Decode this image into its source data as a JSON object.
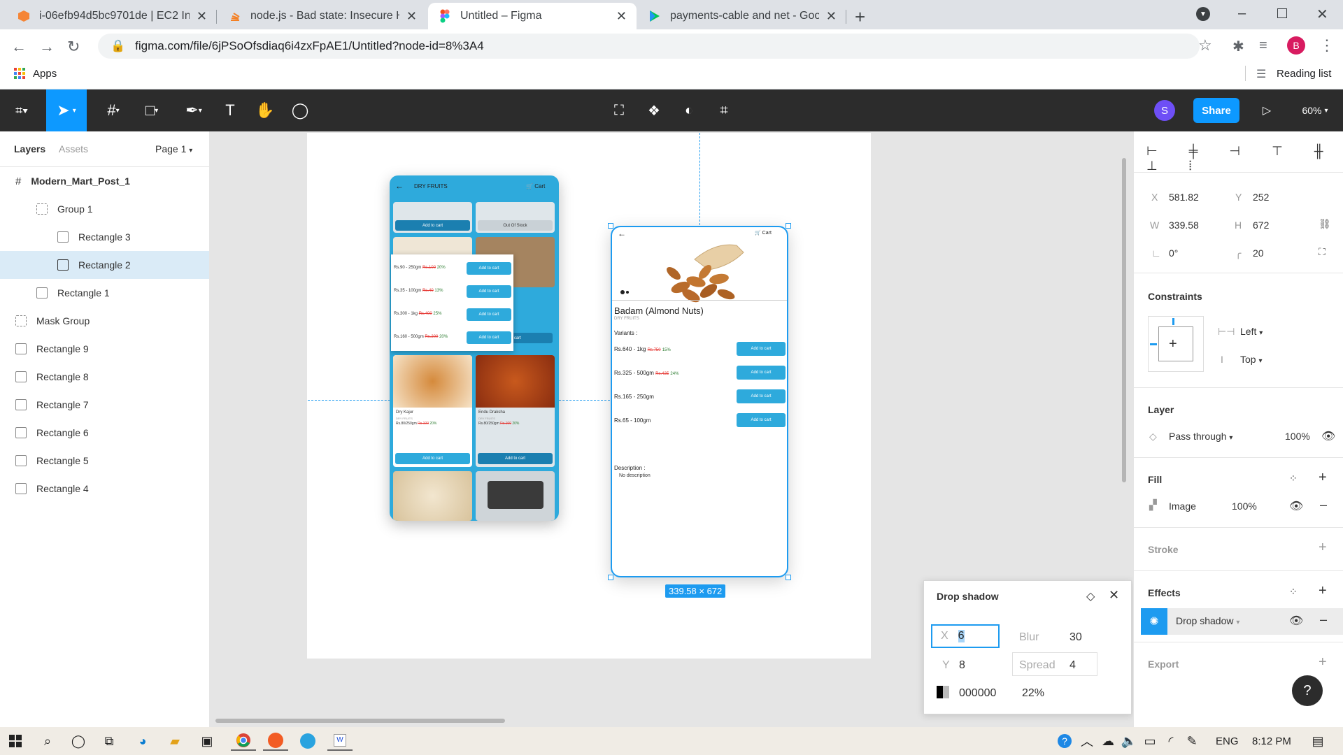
{
  "browser": {
    "tabs": [
      {
        "title": "i-06efb94d5bc9701de | EC2 Insta",
        "icon": "aws-icon"
      },
      {
        "title": "node.js - Bad state: Insecure HTT",
        "icon": "stackoverflow-icon"
      },
      {
        "title": "Untitled – Figma",
        "icon": "figma-icon"
      },
      {
        "title": "payments-cable and net - Googl",
        "icon": "google-play-icon"
      }
    ],
    "url": "figma.com/file/6jPSoOfsdiaq6i4zxFpAE1/Untitled?node-id=8%3A4",
    "apps_label": "Apps",
    "reading_list": "Reading list",
    "profile_initial": "B"
  },
  "figma": {
    "avatar": "S",
    "share_label": "Share",
    "zoom": "60%",
    "left_tabs": {
      "layers": "Layers",
      "assets": "Assets",
      "page": "Page 1"
    },
    "layers": [
      {
        "name": "Modern_Mart_Post_1",
        "indent": 0,
        "type": "frame"
      },
      {
        "name": "Group 1",
        "indent": 1,
        "type": "group"
      },
      {
        "name": "Rectangle 3",
        "indent": 2,
        "type": "image"
      },
      {
        "name": "Rectangle 2",
        "indent": 2,
        "type": "image",
        "selected": true
      },
      {
        "name": "Rectangle 1",
        "indent": 1,
        "type": "rect"
      },
      {
        "name": "Mask Group",
        "indent": 0,
        "type": "group"
      },
      {
        "name": "Rectangle 9",
        "indent": 0,
        "type": "image"
      },
      {
        "name": "Rectangle 8",
        "indent": 0,
        "type": "image"
      },
      {
        "name": "Rectangle 7",
        "indent": 0,
        "type": "rect"
      },
      {
        "name": "Rectangle 6",
        "indent": 0,
        "type": "image"
      },
      {
        "name": "Rectangle 5",
        "indent": 0,
        "type": "image"
      },
      {
        "name": "Rectangle 4",
        "indent": 0,
        "type": "rect"
      }
    ],
    "design": {
      "x": "581.82",
      "y": "252",
      "w": "339.58",
      "h": "672",
      "rotation": "0°",
      "radius": "20",
      "labels": {
        "x": "X",
        "y": "Y",
        "w": "W",
        "h": "H"
      },
      "constraints_title": "Constraints",
      "constraint_h": "Left",
      "constraint_v": "Top",
      "layer_title": "Layer",
      "blend": "Pass through",
      "opacity": "100%",
      "fill_title": "Fill",
      "fill_type": "Image",
      "fill_opacity": "100%",
      "stroke_title": "Stroke",
      "effects_title": "Effects",
      "effect_name": "Drop shadow",
      "export_title": "Export"
    },
    "selection_size": "339.58 × 672",
    "drop_shadow": {
      "title": "Drop shadow",
      "x_label": "X",
      "x": "6",
      "y_label": "Y",
      "y": "8",
      "blur_label": "Blur",
      "blur": "30",
      "spread_label": "Spread",
      "spread": "4",
      "color": "000000",
      "opacity": "22%"
    }
  },
  "phone_left": {
    "header": "DRY FRUITS",
    "cart": "Cart",
    "add_to_cart": "Add to cart",
    "out_of_stock": "Out Of Stock",
    "variants": [
      {
        "label": "Rs.90 - 250gm",
        "old": "Rs.100",
        "off": "20%"
      },
      {
        "label": "Rs.35 - 100gm",
        "old": "Rs.40",
        "off": "13%"
      },
      {
        "label": "Rs.300 - 1kg",
        "old": "Rs.400",
        "off": "25%"
      },
      {
        "label": "Rs.160 - 500gm",
        "old": "Rs.200",
        "off": "20%"
      }
    ],
    "items": [
      {
        "name": "Dry Kajur",
        "cat": "DRY FRUITS",
        "price": "Rs.80/250gm",
        "old": "Rs.100",
        "off": "20%"
      },
      {
        "name": "Endu Draksha",
        "cat": "DRY FRUITS",
        "price": "Rs.80/250gm",
        "old": "Rs.100",
        "off": "20%"
      }
    ]
  },
  "phone_right": {
    "cart": "Cart",
    "title": "Badam (Almond Nuts)",
    "category": "DRY FRUITS",
    "variants_label": "Variants :",
    "variants": [
      {
        "label": "Rs.640 - 1kg",
        "old": "Rs.750",
        "off": "15%"
      },
      {
        "label": "Rs.325 - 500gm",
        "old": "Rs.425",
        "off": "24%"
      },
      {
        "label": "Rs.165 - 250gm",
        "old": "",
        "off": ""
      },
      {
        "label": "Rs.65 - 100gm",
        "old": "",
        "off": ""
      }
    ],
    "add_to_cart": "Add to cart",
    "description_label": "Description :",
    "description": "No description"
  },
  "taskbar": {
    "lang": "ENG",
    "time": "8:12 PM"
  }
}
